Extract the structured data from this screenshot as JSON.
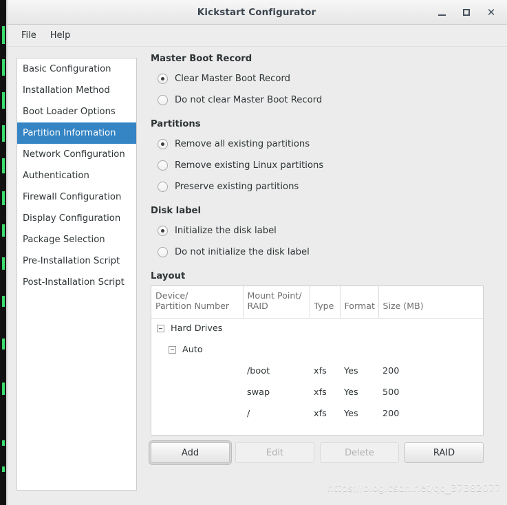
{
  "window": {
    "title": "Kickstart Configurator",
    "controls": [
      {
        "name": "minimize",
        "glyph": "_"
      },
      {
        "name": "maximize",
        "glyph": "□"
      },
      {
        "name": "close",
        "glyph": "✕"
      }
    ]
  },
  "menubar": {
    "items": [
      {
        "label": "File"
      },
      {
        "label": "Help"
      }
    ]
  },
  "sidebar": {
    "items": [
      {
        "label": "Basic Configuration",
        "selected": false
      },
      {
        "label": "Installation Method",
        "selected": false
      },
      {
        "label": "Boot Loader Options",
        "selected": false
      },
      {
        "label": "Partition Information",
        "selected": true
      },
      {
        "label": "Network Configuration",
        "selected": false
      },
      {
        "label": "Authentication",
        "selected": false
      },
      {
        "label": "Firewall Configuration",
        "selected": false
      },
      {
        "label": "Display Configuration",
        "selected": false
      },
      {
        "label": "Package Selection",
        "selected": false
      },
      {
        "label": "Pre-Installation Script",
        "selected": false
      },
      {
        "label": "Post-Installation Script",
        "selected": false
      }
    ]
  },
  "main": {
    "groups": [
      {
        "title": "Master Boot Record",
        "options": [
          {
            "label": "Clear Master Boot Record",
            "checked": true
          },
          {
            "label": "Do not clear Master Boot Record",
            "checked": false
          }
        ]
      },
      {
        "title": "Partitions",
        "options": [
          {
            "label": "Remove all existing partitions",
            "checked": true
          },
          {
            "label": "Remove existing Linux partitions",
            "checked": false
          },
          {
            "label": "Preserve existing partitions",
            "checked": false
          }
        ]
      },
      {
        "title": "Disk label",
        "options": [
          {
            "label": "Initialize the disk label",
            "checked": true
          },
          {
            "label": "Do not initialize the disk label",
            "checked": false
          }
        ]
      }
    ],
    "layout": {
      "title": "Layout",
      "columns": [
        "Device/\nPartition Number",
        "Mount Point/\nRAID",
        "Type",
        "Format",
        "Size (MB)"
      ],
      "column_lines": [
        [
          "Device/",
          "Partition Number"
        ],
        [
          "Mount Point/",
          "RAID"
        ],
        [
          "Type",
          ""
        ],
        [
          "Format",
          ""
        ],
        [
          "Size (MB)",
          ""
        ]
      ],
      "rows": [
        {
          "kind": "group",
          "indent": 1,
          "expanded": true,
          "device": "Hard Drives",
          "mount": "",
          "type": "",
          "format": "",
          "size": ""
        },
        {
          "kind": "group",
          "indent": 2,
          "expanded": true,
          "device": "Auto",
          "mount": "",
          "type": "",
          "format": "",
          "size": ""
        },
        {
          "kind": "part",
          "indent": 3,
          "expanded": false,
          "device": "",
          "mount": "/boot",
          "type": "xfs",
          "format": "Yes",
          "size": "200"
        },
        {
          "kind": "part",
          "indent": 3,
          "expanded": false,
          "device": "",
          "mount": "swap",
          "type": "xfs",
          "format": "Yes",
          "size": "500"
        },
        {
          "kind": "part",
          "indent": 3,
          "expanded": false,
          "device": "",
          "mount": "/",
          "type": "xfs",
          "format": "Yes",
          "size": "200"
        }
      ]
    },
    "buttons": [
      {
        "label": "Add",
        "enabled": true,
        "focused": true
      },
      {
        "label": "Edit",
        "enabled": false,
        "focused": false
      },
      {
        "label": "Delete",
        "enabled": false,
        "focused": false
      },
      {
        "label": "RAID",
        "enabled": true,
        "focused": false
      }
    ]
  },
  "watermark": {
    "text": "https://blog.csdn.net/qq_37382077"
  },
  "colors": {
    "accent": "#3584c4",
    "window_bg": "#ececec",
    "panel_bg": "#ffffff",
    "text": "#2e3436",
    "muted_text": "#6f6f6f",
    "disabled_text": "#b2b2b2"
  }
}
